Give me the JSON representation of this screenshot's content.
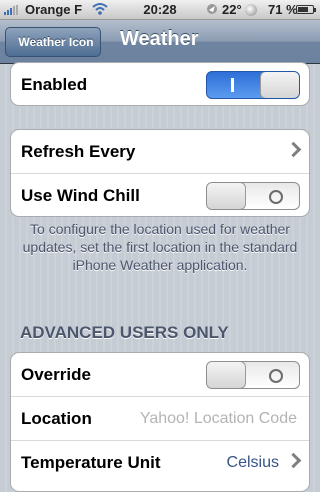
{
  "status_bar": {
    "carrier": "Orange F",
    "time": "20:28",
    "temperature": "22°",
    "battery": "71 %",
    "battery_level": 0.71
  },
  "nav": {
    "back_label": "Weather Icon",
    "title": "Weather"
  },
  "group1": {
    "enabled_label": "Enabled",
    "enabled_on": true
  },
  "group2": {
    "refresh_label": "Refresh Every",
    "wind_chill_label": "Use Wind Chill",
    "wind_chill_on": false
  },
  "footer_note": "To configure the location used for weather updates, set the first location in the standard iPhone Weather application.",
  "section_header": "ADVANCED USERS ONLY",
  "group3": {
    "override_label": "Override",
    "override_on": false,
    "location_label": "Location",
    "location_placeholder": "Yahoo! Location Code",
    "temp_unit_label": "Temperature Unit",
    "temp_unit_value": "Celsius"
  },
  "colors": {
    "accent_blue": "#2d6fd6",
    "nav_bar": "#6f84a0",
    "value_text": "#385487"
  }
}
